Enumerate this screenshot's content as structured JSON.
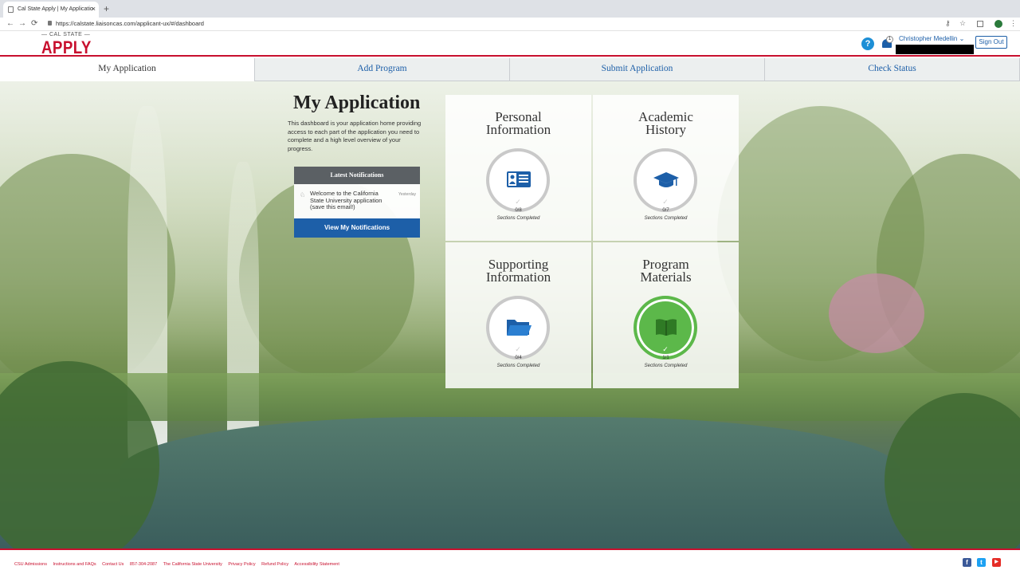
{
  "browser": {
    "tab_title": "Cal State Apply | My Applicatio",
    "tab_close": "×",
    "new_tab": "+",
    "back": "←",
    "forward": "→",
    "reload": "⟳",
    "url": "https://calstate.liaisoncas.com/applicant-ux/#/dashboard",
    "key_icon": "⚷",
    "star_icon": "☆",
    "menu_icon": "⋮"
  },
  "header": {
    "logo_small": "— CAL STATE —",
    "logo_big": "APPLY",
    "help_label": "?",
    "notification_count": "1",
    "user_name": "Christopher Medellin ⌄",
    "sign_out_label": "Sign Out"
  },
  "nav": {
    "tabs": [
      {
        "label": "My Application"
      },
      {
        "label": "Add Program"
      },
      {
        "label": "Submit Application"
      },
      {
        "label": "Check Status"
      }
    ]
  },
  "intro": {
    "title": "My Application",
    "description": "This dashboard is your application home providing access to each part of the application you need to complete and a high level overview of your progress."
  },
  "notifications": {
    "header": "Latest Notifications",
    "item_text": "Welcome to the California State University application (save this email!)",
    "item_date": "Yesterday",
    "button_label": "View My Notifications"
  },
  "sections": [
    {
      "title_line1": "Personal",
      "title_line2": "Information",
      "count": "0/8",
      "caption": "Sections Completed",
      "icon": "id-card-icon",
      "complete": false
    },
    {
      "title_line1": "Academic",
      "title_line2": "History",
      "count": "0/7",
      "caption": "Sections Completed",
      "icon": "graduation-cap-icon",
      "complete": false
    },
    {
      "title_line1": "Supporting",
      "title_line2": "Information",
      "count": "0/4",
      "caption": "Sections Completed",
      "icon": "folder-icon",
      "complete": false
    },
    {
      "title_line1": "Program",
      "title_line2": "Materials",
      "count": "1/1",
      "caption": "Sections Completed",
      "icon": "book-icon",
      "complete": true
    }
  ],
  "footer": {
    "links": [
      "CSU Admissions",
      "Instructions and FAQs",
      "Contact Us",
      "857-304-2087",
      "The California State University",
      "Privacy Policy",
      "Refund Policy",
      "Accessibility Statement"
    ],
    "social": [
      {
        "icon": "facebook-icon",
        "glyph": "f",
        "color": "#3b5998"
      },
      {
        "icon": "twitter-icon",
        "glyph": "t",
        "color": "#1da1f2"
      },
      {
        "icon": "youtube-icon",
        "glyph": "▶",
        "color": "#e52d27"
      }
    ]
  },
  "colors": {
    "brand_red": "#c8102e",
    "link_blue": "#1d5fa8",
    "complete_green": "#5cb84a"
  }
}
